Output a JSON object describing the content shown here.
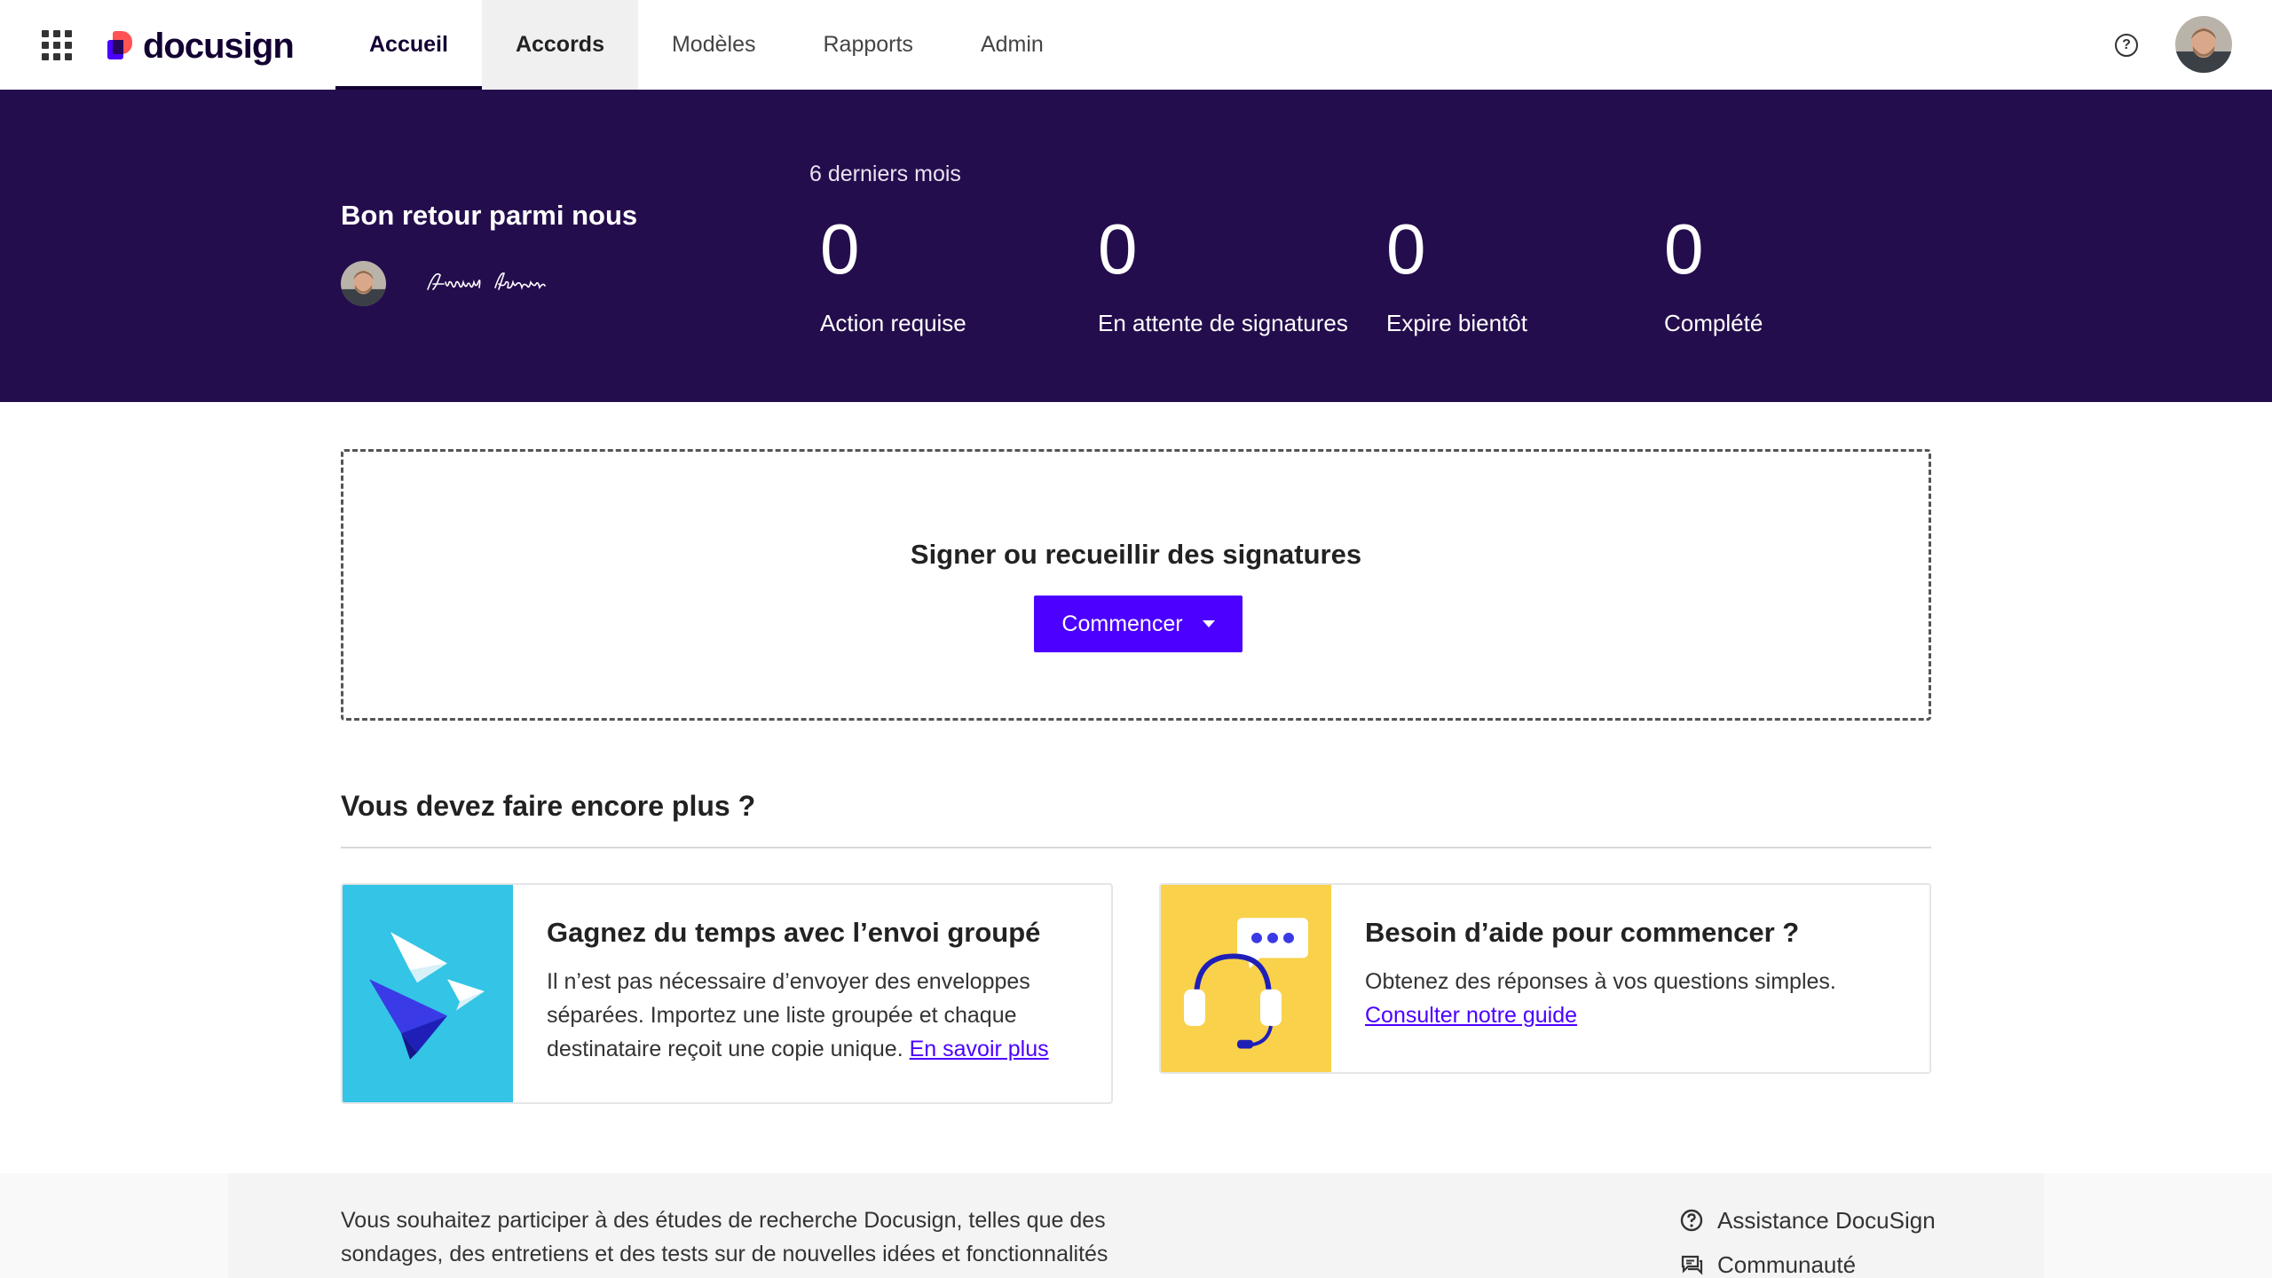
{
  "brand": {
    "name": "docusign"
  },
  "nav": {
    "tabs": [
      {
        "label": "Accueil"
      },
      {
        "label": "Accords"
      },
      {
        "label": "Modèles"
      },
      {
        "label": "Rapports"
      },
      {
        "label": "Admin"
      }
    ],
    "active_tab": "Accueil",
    "hovered_tab": "Accords"
  },
  "hero": {
    "welcome": "Bon retour parmi nous",
    "signature_text": "Arnaud Leoneur",
    "period": "6 derniers mois",
    "stats": [
      {
        "value": "0",
        "label": "Action requise"
      },
      {
        "value": "0",
        "label": "En attente de signatures"
      },
      {
        "value": "0",
        "label": "Expire bientôt"
      },
      {
        "value": "0",
        "label": "Complété"
      }
    ]
  },
  "start": {
    "title": "Signer ou recueillir des signatures",
    "button_label": "Commencer"
  },
  "more": {
    "title": "Vous devez faire encore plus ?",
    "cards": [
      {
        "title": "Gagnez du temps avec l’envoi groupé",
        "text": "Il n’est pas nécessaire d’envoyer des enveloppes séparées. Importez une liste groupée et chaque destinataire reçoit une copie unique.",
        "link": "En savoir plus"
      },
      {
        "title": "Besoin d’aide pour commencer ?",
        "text": "Obtenez des réponses à vos questions simples.",
        "link": "Consulter notre guide"
      }
    ]
  },
  "footer": {
    "text": "Vous souhaitez participer à des études de recherche Docusign, telles que des sondages, des entretiens et des tests sur de nouvelles idées et fonctionnalités",
    "links": [
      {
        "label": "Assistance DocuSign",
        "icon": "help-circle-icon"
      },
      {
        "label": "Communauté",
        "icon": "chat-icon"
      }
    ]
  },
  "colors": {
    "hero_bg": "#240d4d",
    "accent": "#4c00ff",
    "promo_blue": "#33c4e6",
    "promo_yellow": "#f9d14b"
  }
}
